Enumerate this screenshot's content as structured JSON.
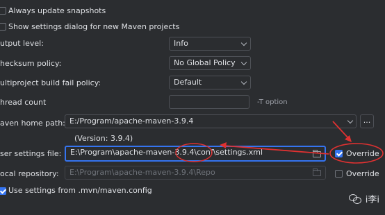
{
  "checkboxes": {
    "always_update": {
      "label": "Always update snapshots",
      "checked": false
    },
    "show_settings_dialog": {
      "label": "Show settings dialog for new Maven projects",
      "checked": false
    },
    "use_mvn_config": {
      "label": "Use settings from .mvn/maven.config",
      "checked": true
    }
  },
  "output_level": {
    "label": "utput level:",
    "value": "Info"
  },
  "checksum_policy": {
    "label": "hecksum policy:",
    "value": "No Global Policy"
  },
  "multiproject_fail_policy": {
    "label": "ultiproject build fail policy:",
    "value": "Default"
  },
  "thread_count": {
    "label": "hread count",
    "value": "",
    "suffix": "-T option"
  },
  "maven_home": {
    "label": "aven home path:",
    "value": "E:/Program/apache-maven-3.9.4",
    "version": "(Version: 3.9.4)",
    "more_label": "..."
  },
  "user_settings": {
    "label": "ser settings file:",
    "value": "E:\\Program\\apache-maven-3.9.4\\conf\\settings.xml",
    "override_label": "Override",
    "override_checked": true
  },
  "local_repository": {
    "label": "ocal repository:",
    "value": "E:\\Program\\apache-maven-3.9.4\\Repo",
    "override_label": "Override",
    "override_checked": false
  },
  "watermark": {
    "text": "i李i"
  },
  "annotation_color": "#e03131"
}
